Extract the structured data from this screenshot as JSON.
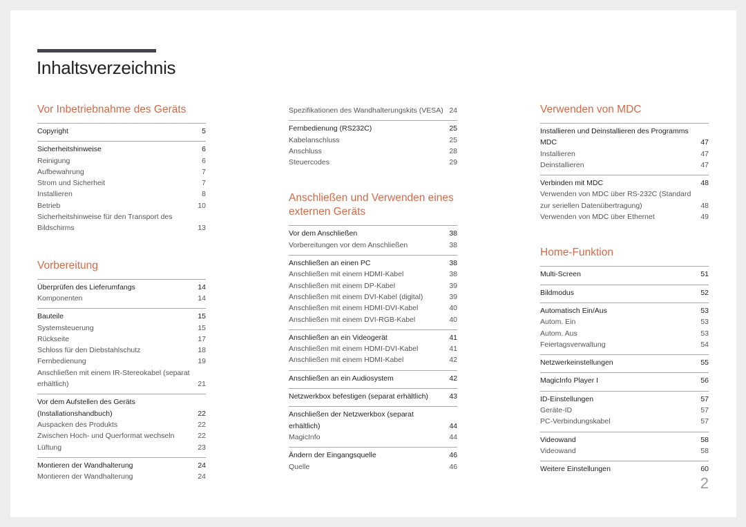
{
  "title": "Inhaltsverzeichnis",
  "page_number": "2",
  "colors": {
    "accent": "#d06b4a",
    "title_bar": "#44424f",
    "rule": "#a8a8a8"
  },
  "columns": [
    {
      "sections": [
        {
          "title": "Vor Inbetriebnahme des Geräts",
          "groups": [
            {
              "entries": [
                {
                  "label": "Copyright",
                  "page": "5",
                  "main": true
                }
              ]
            },
            {
              "entries": [
                {
                  "label": "Sicherheitshinweise",
                  "page": "6",
                  "main": true
                },
                {
                  "label": "Reinigung",
                  "page": "6"
                },
                {
                  "label": "Aufbewahrung",
                  "page": "7"
                },
                {
                  "label": "Strom und Sicherheit",
                  "page": "7"
                },
                {
                  "label": "Installieren",
                  "page": "8"
                },
                {
                  "label": "Betrieb",
                  "page": "10"
                },
                {
                  "label": "Sicherheitshinweise für den Transport des Bildschirms",
                  "page": "13"
                }
              ]
            }
          ]
        },
        {
          "title": "Vorbereitung",
          "groups": [
            {
              "entries": [
                {
                  "label": "Überprüfen des Lieferumfangs",
                  "page": "14",
                  "main": true
                },
                {
                  "label": "Komponenten",
                  "page": "14"
                }
              ]
            },
            {
              "entries": [
                {
                  "label": "Bauteile",
                  "page": "15",
                  "main": true
                },
                {
                  "label": "Systemsteuerung",
                  "page": "15"
                },
                {
                  "label": "Rückseite",
                  "page": "17"
                },
                {
                  "label": "Schloss für den Diebstahlschutz",
                  "page": "18"
                },
                {
                  "label": "Fernbedienung",
                  "page": "19"
                },
                {
                  "label": "Anschließen mit einem IR-Stereokabel (separat erhältlich)",
                  "page": "21"
                }
              ]
            },
            {
              "entries": [
                {
                  "label": "Vor dem Aufstellen des Geräts (Installationshandbuch)",
                  "page": "22",
                  "main": true
                },
                {
                  "label": "Auspacken des Produkts",
                  "page": "22"
                },
                {
                  "label": "Zwischen Hoch- und Querformat wechseln",
                  "page": "22"
                },
                {
                  "label": "Lüftung",
                  "page": "23"
                }
              ]
            },
            {
              "entries": [
                {
                  "label": "Montieren der Wandhalterung",
                  "page": "24",
                  "main": true
                },
                {
                  "label": "Montieren der Wandhalterung",
                  "page": "24"
                }
              ]
            }
          ]
        }
      ]
    },
    {
      "sections": [
        {
          "title": "",
          "groups": [
            {
              "entries": [
                {
                  "label": "Spezifikationen des Wandhalterungskits (VESA)",
                  "page": "24"
                }
              ]
            },
            {
              "entries": [
                {
                  "label": "Fernbedienung (RS232C)",
                  "page": "25",
                  "main": true
                },
                {
                  "label": "Kabelanschluss",
                  "page": "25"
                },
                {
                  "label": "Anschluss",
                  "page": "28"
                },
                {
                  "label": "Steuercodes",
                  "page": "29"
                }
              ]
            }
          ]
        },
        {
          "title": "Anschließen und Verwenden eines externen Geräts",
          "groups": [
            {
              "entries": [
                {
                  "label": "Vor dem Anschließen",
                  "page": "38",
                  "main": true
                },
                {
                  "label": "Vorbereitungen vor dem Anschließen",
                  "page": "38"
                }
              ]
            },
            {
              "entries": [
                {
                  "label": "Anschließen an einen PC",
                  "page": "38",
                  "main": true
                },
                {
                  "label": "Anschließen mit einem HDMI-Kabel",
                  "page": "38"
                },
                {
                  "label": "Anschließen mit einem DP-Kabel",
                  "page": "39"
                },
                {
                  "label": "Anschließen mit einem DVI-Kabel (digital)",
                  "page": "39"
                },
                {
                  "label": "Anschließen mit einem HDMI-DVI-Kabel",
                  "page": "40"
                },
                {
                  "label": "Anschließen mit einem DVI-RGB-Kabel",
                  "page": "40"
                }
              ]
            },
            {
              "entries": [
                {
                  "label": "Anschließen an ein Videogerät",
                  "page": "41",
                  "main": true
                },
                {
                  "label": "Anschließen mit einem HDMI-DVI-Kabel",
                  "page": "41"
                },
                {
                  "label": "Anschließen mit einem HDMI-Kabel",
                  "page": "42"
                }
              ]
            },
            {
              "entries": [
                {
                  "label": "Anschließen an ein Audiosystem",
                  "page": "42",
                  "main": true
                }
              ]
            },
            {
              "entries": [
                {
                  "label": "Netzwerkbox befestigen (separat erhältlich)",
                  "page": "43",
                  "main": true
                }
              ]
            },
            {
              "entries": [
                {
                  "label": "Anschließen der Netzwerkbox (separat erhältlich)",
                  "page": "44",
                  "main": true
                },
                {
                  "label": "MagicInfo",
                  "page": "44"
                }
              ]
            },
            {
              "entries": [
                {
                  "label": "Ändern der Eingangsquelle",
                  "page": "46",
                  "main": true
                },
                {
                  "label": "Quelle",
                  "page": "46"
                }
              ]
            }
          ]
        }
      ]
    },
    {
      "sections": [
        {
          "title": "Verwenden von MDC",
          "groups": [
            {
              "entries": [
                {
                  "label": "Installieren und Deinstallieren des Programms MDC",
                  "page": "47",
                  "main": true
                },
                {
                  "label": "Installieren",
                  "page": "47"
                },
                {
                  "label": "Deinstallieren",
                  "page": "47"
                }
              ]
            },
            {
              "entries": [
                {
                  "label": "Verbinden mit MDC",
                  "page": "48",
                  "main": true
                },
                {
                  "label": "Verwenden von MDC über RS-232C (Standard zur seriellen Datenübertragung)",
                  "page": "48"
                },
                {
                  "label": "Verwenden von MDC über Ethernet",
                  "page": "49"
                }
              ]
            }
          ]
        },
        {
          "title": "Home-Funktion",
          "groups": [
            {
              "entries": [
                {
                  "label": "Multi-Screen",
                  "page": "51",
                  "main": true
                }
              ]
            },
            {
              "entries": [
                {
                  "label": "Bildmodus",
                  "page": "52",
                  "main": true
                }
              ]
            },
            {
              "entries": [
                {
                  "label": "Automatisch Ein/Aus",
                  "page": "53",
                  "main": true
                },
                {
                  "label": "Autom. Ein",
                  "page": "53"
                },
                {
                  "label": "Autom. Aus",
                  "page": "53"
                },
                {
                  "label": "Feiertagsverwaltung",
                  "page": "54"
                }
              ]
            },
            {
              "entries": [
                {
                  "label": "Netzwerkeinstellungen",
                  "page": "55",
                  "main": true
                }
              ]
            },
            {
              "entries": [
                {
                  "label": "MagicInfo Player I",
                  "page": "56",
                  "main": true
                }
              ]
            },
            {
              "entries": [
                {
                  "label": "ID-Einstellungen",
                  "page": "57",
                  "main": true
                },
                {
                  "label": "Geräte-ID",
                  "page": "57"
                },
                {
                  "label": "PC-Verbindungskabel",
                  "page": "57"
                }
              ]
            },
            {
              "entries": [
                {
                  "label": "Videowand",
                  "page": "58",
                  "main": true
                },
                {
                  "label": "Videowand",
                  "page": "58"
                }
              ]
            },
            {
              "entries": [
                {
                  "label": "Weitere Einstellungen",
                  "page": "60",
                  "main": true
                }
              ]
            }
          ]
        }
      ]
    }
  ]
}
